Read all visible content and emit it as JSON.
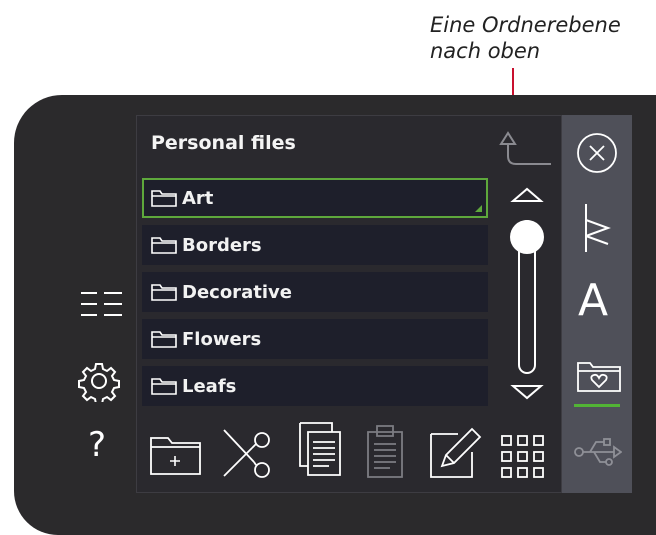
{
  "annotation": {
    "line1": "Eine Ordnerebene",
    "line2": "nach oben"
  },
  "panel": {
    "title": "Personal files"
  },
  "files": [
    {
      "label": "Art",
      "selected": true
    },
    {
      "label": "Borders",
      "selected": false
    },
    {
      "label": "Decorative",
      "selected": false
    },
    {
      "label": "Flowers",
      "selected": false
    },
    {
      "label": "Leafs",
      "selected": false
    }
  ],
  "left_sidebar": {
    "help_label": "?",
    "icons": [
      "menu-lines-icon",
      "settings-gear-icon",
      "help-question-icon"
    ]
  },
  "right_sidebar": {
    "text_label": "A",
    "icons": [
      "close-icon",
      "stitch-menu-icon",
      "font-icon",
      "personal-folder-icon",
      "usb-icon"
    ],
    "active": "personal-folder-icon"
  },
  "toolbar": {
    "icons": [
      "new-folder-icon",
      "cut-icon",
      "copy-icon",
      "paste-icon",
      "rename-icon",
      "view-grid-icon"
    ]
  },
  "colors": {
    "accent_green": "#52b335",
    "panel_bg": "#2a292e",
    "list_bg": "#1e1f2b",
    "right_bar": "#4f5059",
    "annotation_line": "#c8102e"
  }
}
